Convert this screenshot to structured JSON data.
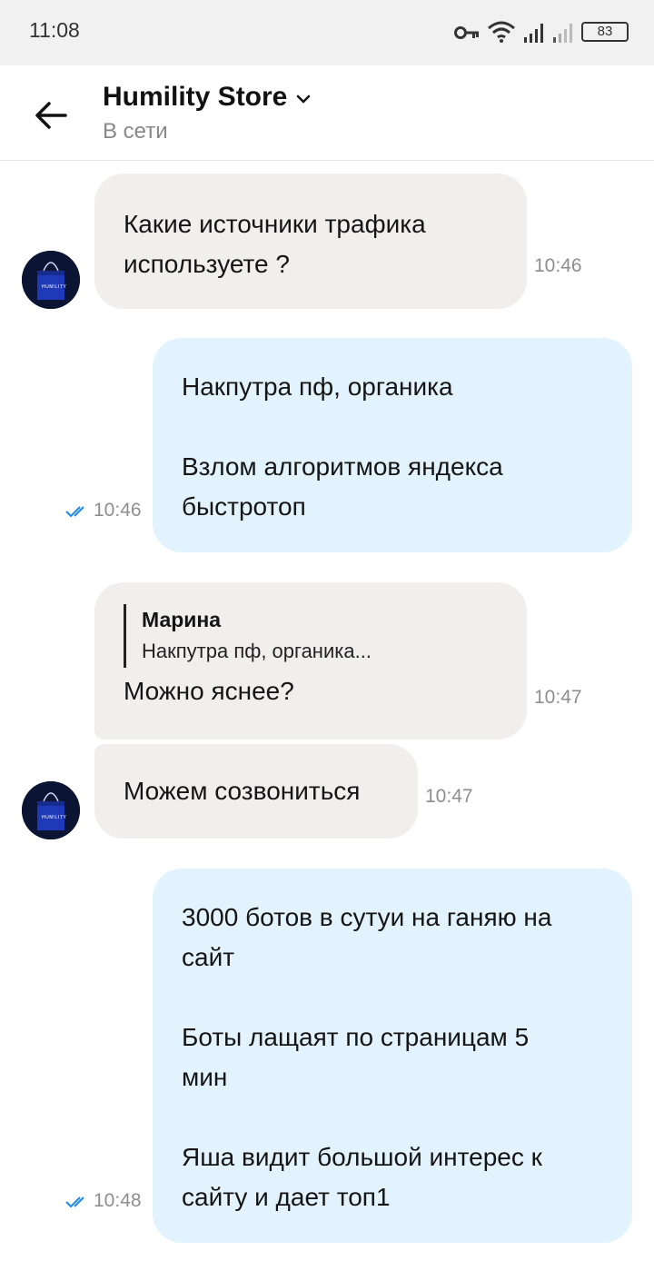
{
  "status_bar": {
    "time": "11:08",
    "battery": "83",
    "icons": [
      "key-icon",
      "wifi-icon",
      "signal-icon",
      "signal-weak-icon",
      "battery-icon"
    ]
  },
  "header": {
    "title": "Humility Store",
    "subtitle": "В сети"
  },
  "avatar_logo": "HUMILITY",
  "messages": [
    {
      "dir": "in",
      "text": "Какие источники трафика\nиспользуете ?",
      "time": "10:46"
    },
    {
      "dir": "out",
      "text": "Накпутра пф, органика\n\nВзлом алгоритмов яндекса\nбыстротоп",
      "time": "10:46",
      "status": "read"
    },
    {
      "dir": "in",
      "reply": {
        "author": "Марина",
        "text": "Накпутра пф, органика..."
      },
      "text": "Можно яснее?",
      "time": "10:47"
    },
    {
      "dir": "in",
      "text": "Можем созвониться",
      "time": "10:47"
    },
    {
      "dir": "out",
      "text": "3000 ботов в сутуи на ганяю на\nсайт\n\nБоты лащаят по страницам 5\nмин\n\nЯша видит большой интерес к\nсайту и дает топ1",
      "time": "10:48",
      "status": "read"
    }
  ],
  "colors": {
    "incoming_bubble": "#f0efee",
    "outgoing_bubble": "#e3f3fd",
    "read_ticks": "#1e88e5"
  }
}
